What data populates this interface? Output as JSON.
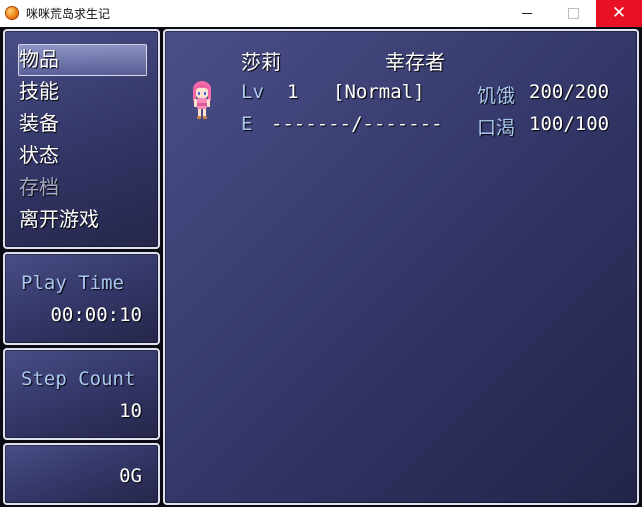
{
  "window": {
    "title": "咪咪荒岛求生记",
    "close_glyph": "✕"
  },
  "menu": {
    "items": [
      {
        "label": "物品",
        "enabled": true,
        "selected": true
      },
      {
        "label": "技能",
        "enabled": true
      },
      {
        "label": "装备",
        "enabled": true
      },
      {
        "label": "状态",
        "enabled": true
      },
      {
        "label": "存档",
        "enabled": false
      },
      {
        "label": "离开游戏",
        "enabled": true
      }
    ]
  },
  "playtime": {
    "label": "Play Time",
    "value": "00:00:10"
  },
  "steps": {
    "label": "Step Count",
    "value": "10"
  },
  "gold": {
    "value": "0G"
  },
  "actor": {
    "name": "莎莉",
    "class": "幸存者",
    "level_label": "Lv",
    "level": "1",
    "state": "[Normal]",
    "exp_label": "E",
    "exp_value": "-------/-------",
    "hunger_label": "饥饿",
    "hunger_value": "200/200",
    "thirst_label": "口渴",
    "thirst_value": "100/100",
    "sprite_icon": "character-sprite-icon"
  },
  "colors": {
    "panel_top": "#4a4e86",
    "panel_bottom": "#24264a",
    "label_blue": "#a9c8f0",
    "close_red": "#e81123"
  }
}
